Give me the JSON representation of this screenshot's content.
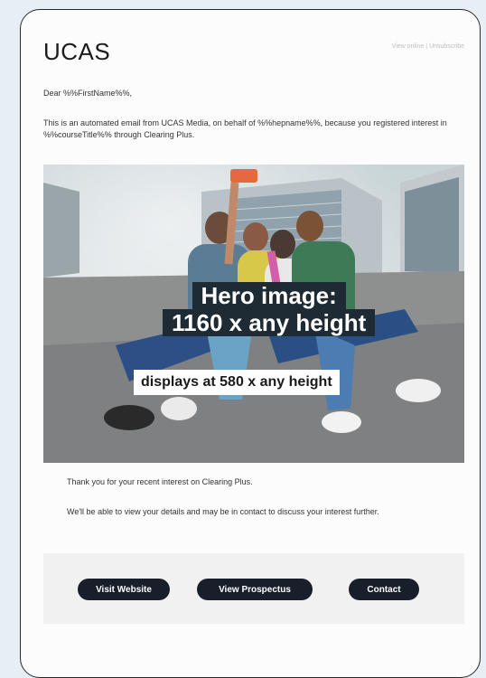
{
  "header": {
    "logo": "UCAS",
    "view_online": "View online",
    "separator": "|",
    "unsubscribe": "Unsubscribe"
  },
  "email": {
    "greeting": "Dear %%FirstName%%,",
    "intro": "This is an automated email from UCAS Media, on behalf of %%hepname%%, because you registered interest in %%courseTitle%% through Clearing Plus.",
    "thanks": "Thank you for your recent interest on Clearing Plus.",
    "contact_note": "We'll be able to view your details and may be in contact to discuss your interest further."
  },
  "hero": {
    "title_line1": "Hero image:",
    "title_line2": "1160 x any height",
    "subtitle": "displays at 580 x any height"
  },
  "buttons": {
    "visit": "Visit Website",
    "prospectus": "View Prospectus",
    "contact": "Contact"
  },
  "colors": {
    "button_bg": "#17202a",
    "hero_label_bg": "#1e2a34",
    "page_bg": "#e7eef6"
  }
}
